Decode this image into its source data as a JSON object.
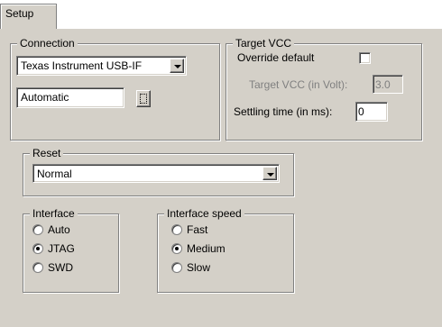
{
  "tabs": [
    {
      "label": "Setup"
    }
  ],
  "connection": {
    "legend": "Connection",
    "interface_select": "Texas Instrument USB-IF",
    "device_field": "Automatic"
  },
  "target_vcc": {
    "legend": "Target VCC",
    "override_label": "Override default",
    "override_checked": false,
    "voltage_label": "Target VCC (in Volt):",
    "voltage_value": "3.0",
    "settling_label": "Settling time (in ms):",
    "settling_value": "0"
  },
  "reset": {
    "legend": "Reset",
    "value": "Normal"
  },
  "interface": {
    "legend": "Interface",
    "options": [
      {
        "label": "Auto",
        "checked": false
      },
      {
        "label": "JTAG",
        "checked": true
      },
      {
        "label": "SWD",
        "checked": false
      }
    ]
  },
  "interface_speed": {
    "legend": "Interface speed",
    "options": [
      {
        "label": "Fast",
        "checked": false
      },
      {
        "label": "Medium",
        "checked": true
      },
      {
        "label": "Slow",
        "checked": false
      }
    ]
  },
  "icons": {
    "combo_arrow": "chevron-down-icon",
    "browse": "browse-dots-icon"
  }
}
